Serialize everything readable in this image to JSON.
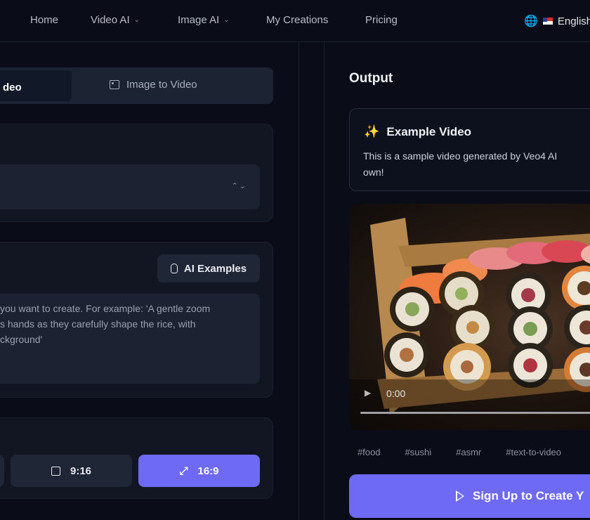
{
  "nav": {
    "items": [
      {
        "label": "Home"
      },
      {
        "label": "Video AI",
        "has_dropdown": true
      },
      {
        "label": "Image AI",
        "has_dropdown": true
      },
      {
        "label": "My Creations"
      },
      {
        "label": "Pricing"
      }
    ],
    "language": "English"
  },
  "left": {
    "tabs": [
      {
        "label": "deo",
        "active": true
      },
      {
        "label": "Image to Video",
        "active": false
      }
    ],
    "ai_examples_label": "AI Examples",
    "prompt_placeholder_lines": [
      "you want to create. For example: 'A gentle zoom",
      "s hands as they carefully shape the rice, with",
      "ckground'"
    ],
    "ratios": [
      {
        "label": "9:16",
        "selected": false
      },
      {
        "label": "16:9",
        "selected": true
      }
    ]
  },
  "output": {
    "title": "Output",
    "example_title": "Example Video",
    "example_desc": "This is a sample video generated by Veo4 AI",
    "example_desc2": "own!",
    "video_time": "0:00",
    "tags": [
      "#food",
      "#sushi",
      "#asmr",
      "#text-to-video"
    ],
    "signup_label": "Sign Up to Create Y"
  },
  "colors": {
    "accent": "#6e6af5",
    "background": "#0a0d18",
    "card": "#111622",
    "input": "#1c2231"
  }
}
